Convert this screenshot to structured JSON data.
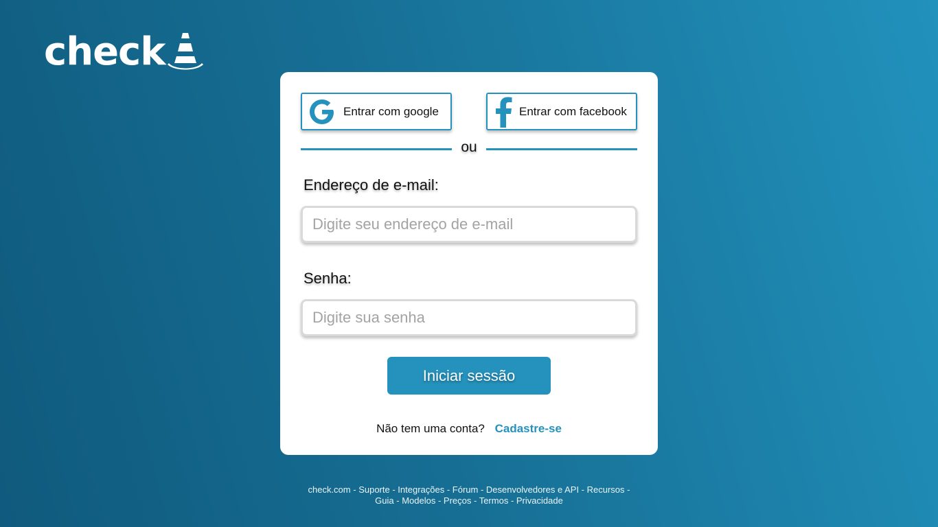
{
  "logo": {
    "text": "check",
    "icon": "traffic-cone-icon"
  },
  "social": {
    "google_label": "Entrar com google",
    "facebook_label": "Entrar com facebook"
  },
  "divider": "ou",
  "email": {
    "label": "Endereço de e-mail:",
    "placeholder": "Digite seu endereço de e-mail",
    "value": ""
  },
  "password": {
    "label": "Senha:",
    "placeholder": "Digite sua senha",
    "value": ""
  },
  "submit_label": "Iniciar sessão",
  "signup": {
    "prompt": "Não tem uma conta?",
    "link": "Cadastre-se"
  },
  "footer": {
    "line1": [
      "check.com",
      "Suporte",
      "Integrações",
      "Fórum",
      "Desenvolvedores e API",
      "Recursos"
    ],
    "line2": [
      "Guia",
      "Modelos",
      "Preços",
      "Termos",
      "Privacidade"
    ]
  },
  "colors": {
    "accent": "#2592bd",
    "background": "#176f95"
  }
}
